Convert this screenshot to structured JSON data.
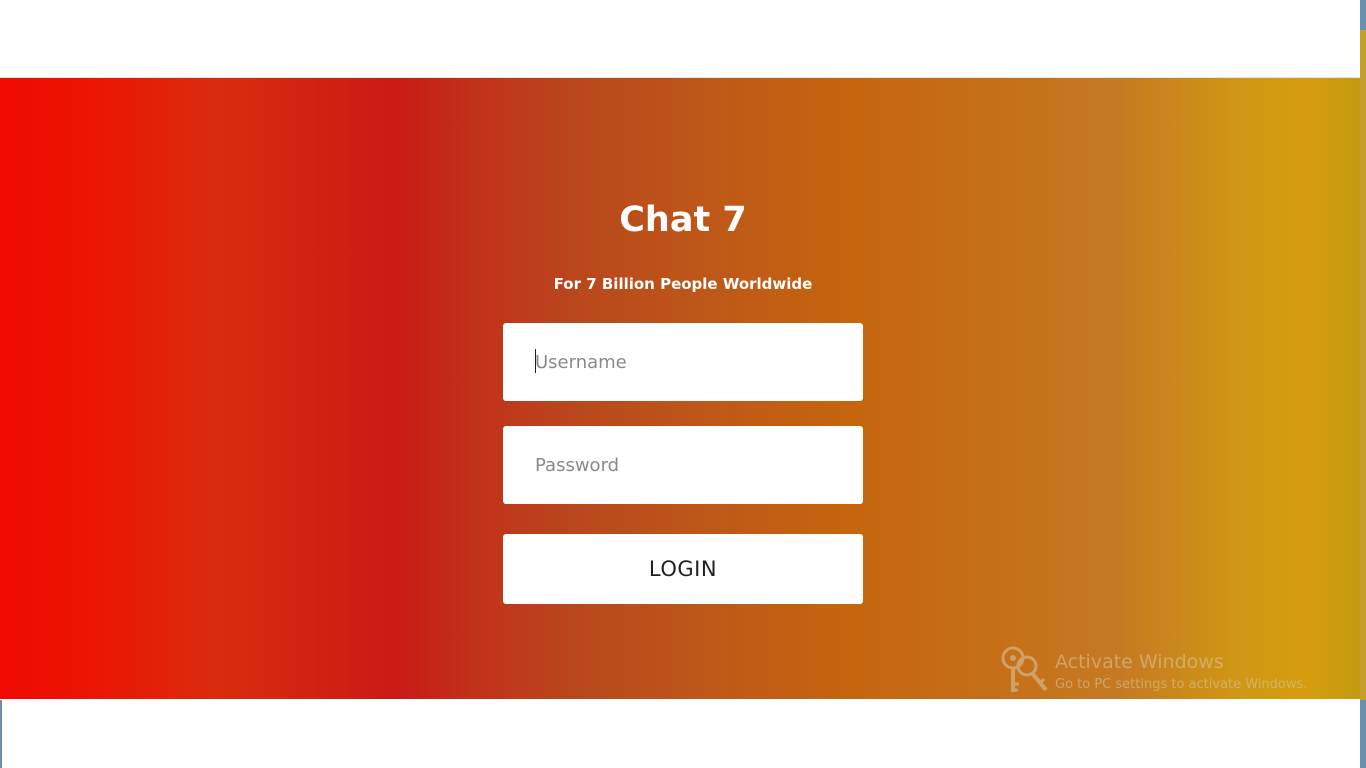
{
  "app": {
    "title": "Chat 7",
    "subtitle": "For 7 Billion People Worldwide"
  },
  "login_form": {
    "username": {
      "value": "",
      "placeholder": "Username"
    },
    "password": {
      "value": "",
      "placeholder": "Password"
    },
    "login_label": "LOGIN"
  },
  "watermark": {
    "title": "Activate Windows",
    "subtitle": "Go to PC settings to activate Windows.",
    "icon": "key-icon"
  },
  "colors": {
    "gradient_start": "#f00a00",
    "gradient_mid": "#c0351b",
    "gradient_end": "#d59d0d",
    "text_on_hero": "#ffffff",
    "field_background": "#ffffff"
  }
}
